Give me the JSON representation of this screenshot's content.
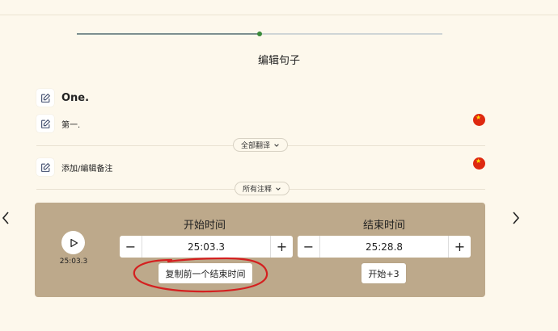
{
  "progress": {
    "fraction": 0.5,
    "accent": "#3a8a3a"
  },
  "page_title": "编辑句子",
  "sentence": {
    "text": "One.",
    "edit_icon": "pencil-icon"
  },
  "translation": {
    "text": "第一.",
    "flag_icon": "china-flag-icon"
  },
  "translate_all": {
    "label": "全部翻译",
    "icon": "chevron-down-icon"
  },
  "note": {
    "text": "添加/编辑备注",
    "flag_icon": "china-flag-icon"
  },
  "all_notes": {
    "label": "所有注释",
    "icon": "chevron-down-icon"
  },
  "nav": {
    "prev_icon": "chevron-left-icon",
    "next_icon": "chevron-right-icon"
  },
  "player": {
    "time": "25:03.3",
    "panel_color": "#bda98b",
    "start": {
      "label": "开始时间",
      "value": "25:03.3",
      "action": "复制前一个结束时间"
    },
    "end": {
      "label": "结束时间",
      "value": "25:28.8",
      "action": "开始+3"
    }
  },
  "annotation": {
    "color": "#d42020"
  }
}
